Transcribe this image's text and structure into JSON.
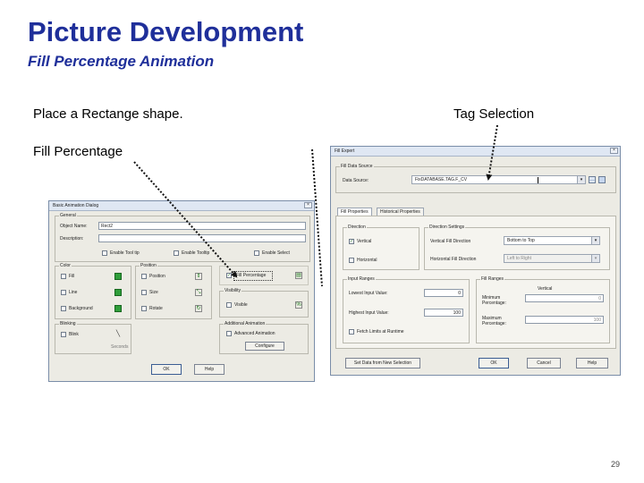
{
  "slide": {
    "title": "Picture Development",
    "subtitle": "Fill Percentage Animation",
    "caption_rect": "Place a Rectange shape.",
    "caption_tag": "Tag Selection",
    "caption_fill": "Fill Percentage",
    "page_number": "29",
    "title_color": "#1f2f9a"
  },
  "basic_dialog": {
    "title": "Basic Animation Dialog",
    "general_label": "General",
    "object_name_label": "Object Name:",
    "object_name_value": "Rect2",
    "description_label": "Description:",
    "checkboxes": [
      "Enable Tool tip",
      "Enable Tooltip",
      "Enable Select"
    ],
    "color_group": "Color",
    "color_items": [
      "Fill",
      "Line",
      "Background"
    ],
    "position_group": "Position",
    "position_items": [
      "Position",
      "Size",
      "Rotate"
    ],
    "fill_percentage_item": "Fill Percentage",
    "visibility_group": "Visibility",
    "visible_item": "Visible",
    "blinking_group": "Blinking",
    "blink_item": "Blink",
    "blink_value": "Seconds",
    "action_group": "Additional Animation",
    "action_item": "Advanced Animation",
    "action_button": "Configure",
    "ok": "OK",
    "help": "Help"
  },
  "fill_expert": {
    "title": "Fill Expert",
    "data_source_group": "Fill Data Source",
    "data_source_label": "Data Source:",
    "data_source_value": "FixDATABASE.TAG.F_CV",
    "tabs": [
      "Fill Properties",
      "Historical Properties"
    ],
    "direction_group": "Direction",
    "vertical": "Vertical",
    "horizontal": "Horizontal",
    "direction_settings_group": "Direction Settings",
    "vertical_fill_label": "Vertical Fill Direction",
    "vertical_fill_value": "Bottom to Top",
    "horizontal_fill_label": "Horizontal Fill Direction",
    "horizontal_fill_value": "Left to Right",
    "input_ranges_group": "Input Ranges",
    "lowest_input_label": "Lowest Input Value:",
    "lowest_input_value": "0",
    "highest_input_label": "Highest Input Value:",
    "highest_input_value": "100",
    "fetch_limits": "Fetch Limits at Runtime",
    "fill_ranges_group": "Fill Ranges",
    "fill_ranges_header": "Vertical",
    "min_pct_label": "Minimum Percentage:",
    "min_pct_value": "0",
    "max_pct_label": "Maximum Percentage:",
    "max_pct_value": "100",
    "btn_set_data": "Set Data from New Selection",
    "btn_ok": "OK",
    "btn_cancel": "Cancel",
    "btn_help": "Help"
  }
}
